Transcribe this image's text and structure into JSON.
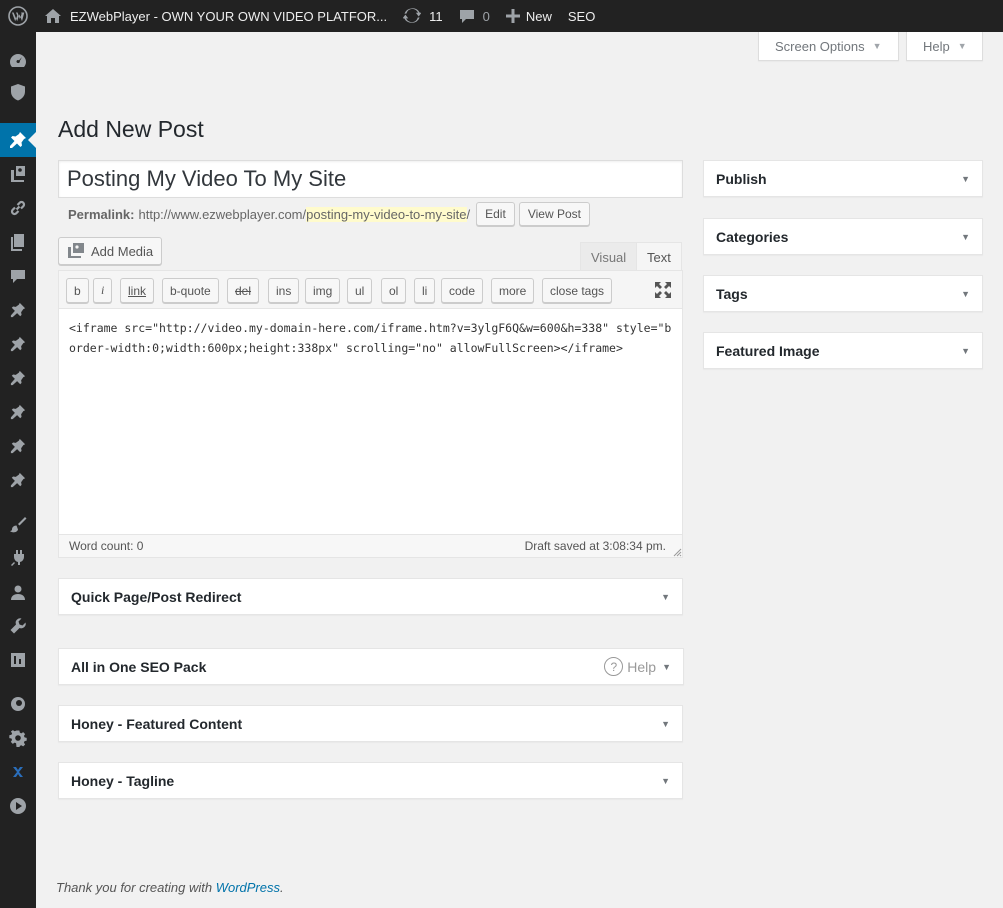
{
  "adminbar": {
    "site_name": "EZWebPlayer - OWN YOUR OWN VIDEO PLATFOR...",
    "updates_count": "11",
    "comments_count": "0",
    "new_label": "New",
    "seo_label": "SEO"
  },
  "screen_meta": {
    "screen_options": "Screen Options",
    "help": "Help"
  },
  "page_title": "Add New Post",
  "post": {
    "title": "Posting My Video To My Site",
    "permalink_label": "Permalink:",
    "permalink_base": "http://www.ezwebplayer.com/",
    "permalink_slug": "posting-my-video-to-my-site",
    "permalink_trail": "/",
    "edit_button": "Edit",
    "view_button": "View Post"
  },
  "editor": {
    "add_media": "Add Media",
    "tab_visual": "Visual",
    "tab_text": "Text",
    "quicktags": [
      "b",
      "i",
      "link",
      "b-quote",
      "del",
      "ins",
      "img",
      "ul",
      "ol",
      "li",
      "code",
      "more",
      "close tags"
    ],
    "content": "<iframe src=\"http://video.my-domain-here.com/iframe.htm?v=3ylgF6Q&w=600&h=338\" style=\"border-width:0;width:600px;height:338px\" scrolling=\"no\" allowFullScreen></iframe>",
    "word_count": "Word count: 0",
    "draft_saved": "Draft saved at 3:08:34 pm."
  },
  "boxes": {
    "quick_redirect": "Quick Page/Post Redirect",
    "aioseo": "All in One SEO Pack",
    "aioseo_help": "Help",
    "honey_featured": "Honey - Featured Content",
    "honey_tagline": "Honey - Tagline"
  },
  "sidebar": {
    "publish": "Publish",
    "categories": "Categories",
    "tags": "Tags",
    "featured_image": "Featured Image"
  },
  "footer": {
    "text": "Thank you for creating with ",
    "link": "WordPress",
    "period": "."
  }
}
